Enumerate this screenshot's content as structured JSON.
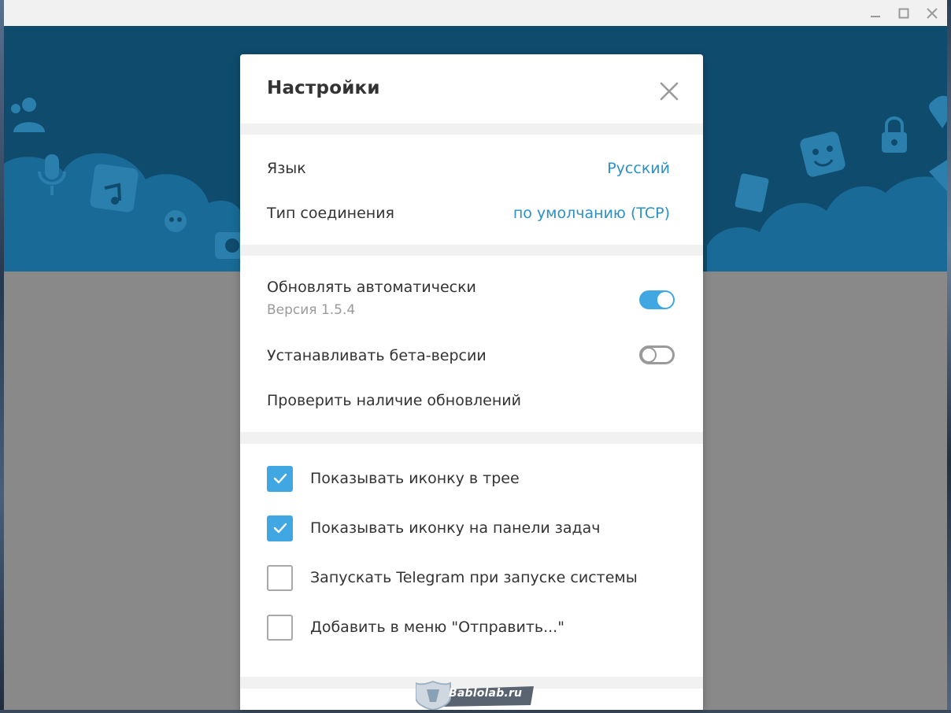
{
  "window": {
    "controls": [
      "minimize",
      "maximize",
      "close"
    ]
  },
  "dialog": {
    "title": "Настройки",
    "close_icon": "close-icon"
  },
  "general": {
    "language_label": "Язык",
    "language_value": "Русский",
    "connection_label": "Тип соединения",
    "connection_value": "по умолчанию (TCP)"
  },
  "updates": {
    "auto_update_label": "Обновлять автоматически",
    "version_label": "Версия 1.5.4",
    "auto_update_on": true,
    "beta_label": "Устанавливать бета-версии",
    "beta_on": false,
    "check_updates_label": "Проверить наличие обновлений"
  },
  "options": [
    {
      "label": "Показывать иконку в трее",
      "checked": true
    },
    {
      "label": "Показывать иконку на панели задач",
      "checked": true
    },
    {
      "label": "Запускать Telegram при запуске системы",
      "checked": false
    },
    {
      "label": "Добавить в меню \"Отправить...\"",
      "checked": false
    }
  ],
  "watermark": {
    "text": "Bablolab.ru"
  },
  "colors": {
    "accent": "#40a7e3",
    "link": "#2c90c6",
    "banner": "#0f4b6d",
    "overlay": "#898989"
  }
}
